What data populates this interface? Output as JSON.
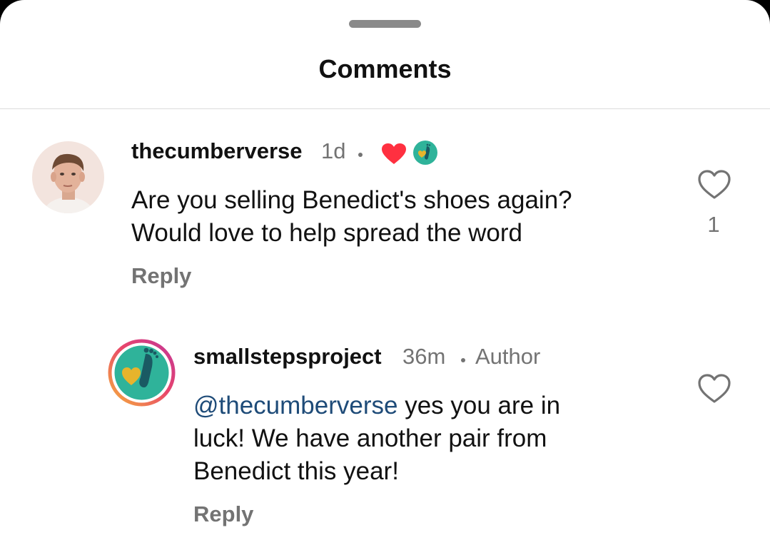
{
  "sheet": {
    "title": "Comments"
  },
  "comments": [
    {
      "username": "thecumberverse",
      "time": "1d",
      "text_line1": "Are you selling Benedict's shoes again?",
      "text_line2": "Would love to help spread the word",
      "reply_label": "Reply",
      "like_count": "1",
      "creator_liked": true,
      "creator_like_heart_color": "#ff3040"
    },
    {
      "username": "smallstepsproject",
      "time": "36m",
      "badge": "Author",
      "mention": "@thecumberverse",
      "text_line1_rest": " yes you are in",
      "text_line2": "luck! We have another pair from",
      "text_line3": "Benedict this year!",
      "reply_label": "Reply"
    }
  ],
  "colors": {
    "mention": "#1e4b78",
    "muted_text": "#737373",
    "brand_teal": "#2fb39a",
    "brand_heart": "#e7b42c",
    "story_ring_start": "#f6b43a",
    "story_ring_end": "#c1359a"
  },
  "icons": {
    "like": "heart-outline-icon",
    "creator_heart": "red-heart-icon",
    "brand_logo": "footprint-heart-logo"
  }
}
